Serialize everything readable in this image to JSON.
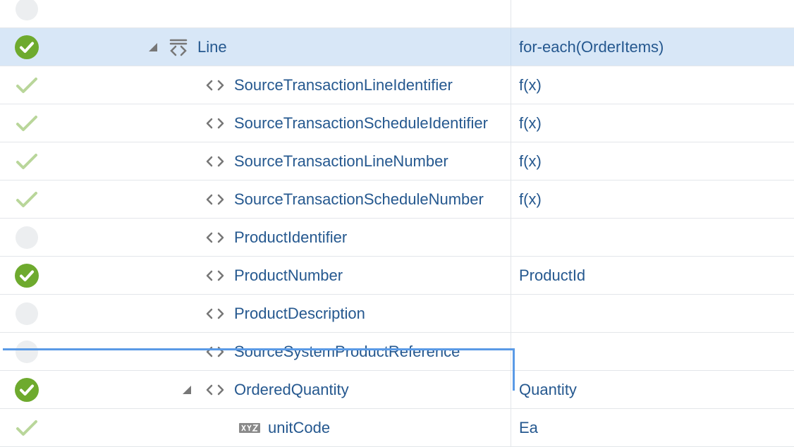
{
  "rows": [
    {
      "name": "",
      "mapping": "",
      "status": "empty"
    },
    {
      "name": "Line",
      "mapping": "for-each(OrderItems)",
      "status": "ok",
      "icon": "repeat-element-icon",
      "expanded": true,
      "selected": true
    },
    {
      "name": "SourceTransactionLineIdentifier",
      "mapping": "f(x)",
      "status": "light",
      "icon": "element-code-icon"
    },
    {
      "name": "SourceTransactionScheduleIdentifier",
      "mapping": "f(x)",
      "status": "light",
      "icon": "element-code-icon"
    },
    {
      "name": "SourceTransactionLineNumber",
      "mapping": "f(x)",
      "status": "light",
      "icon": "element-code-icon"
    },
    {
      "name": "SourceTransactionScheduleNumber",
      "mapping": "f(x)",
      "status": "light",
      "icon": "element-code-icon"
    },
    {
      "name": "ProductIdentifier",
      "mapping": "",
      "status": "empty",
      "icon": "element-code-icon"
    },
    {
      "name": "ProductNumber",
      "mapping": "ProductId",
      "status": "ok",
      "icon": "element-code-icon"
    },
    {
      "name": "ProductDescription",
      "mapping": "",
      "status": "empty",
      "icon": "element-code-icon"
    },
    {
      "name": "SourceSystemProductReference",
      "mapping": "",
      "status": "empty",
      "icon": "element-code-icon"
    },
    {
      "name": "OrderedQuantity",
      "mapping": "Quantity",
      "status": "ok",
      "icon": "element-code-icon",
      "expanded": true,
      "focused": true
    },
    {
      "name": "unitCode",
      "mapping": "Ea",
      "status": "light",
      "icon": "attribute-xyz-icon"
    }
  ],
  "colors": {
    "link": "#25588f",
    "selected_row": "#d8e7f7",
    "ok_green": "#6eaa2e",
    "light_check": "#b9d69a",
    "focus": "#5a9ae6"
  }
}
